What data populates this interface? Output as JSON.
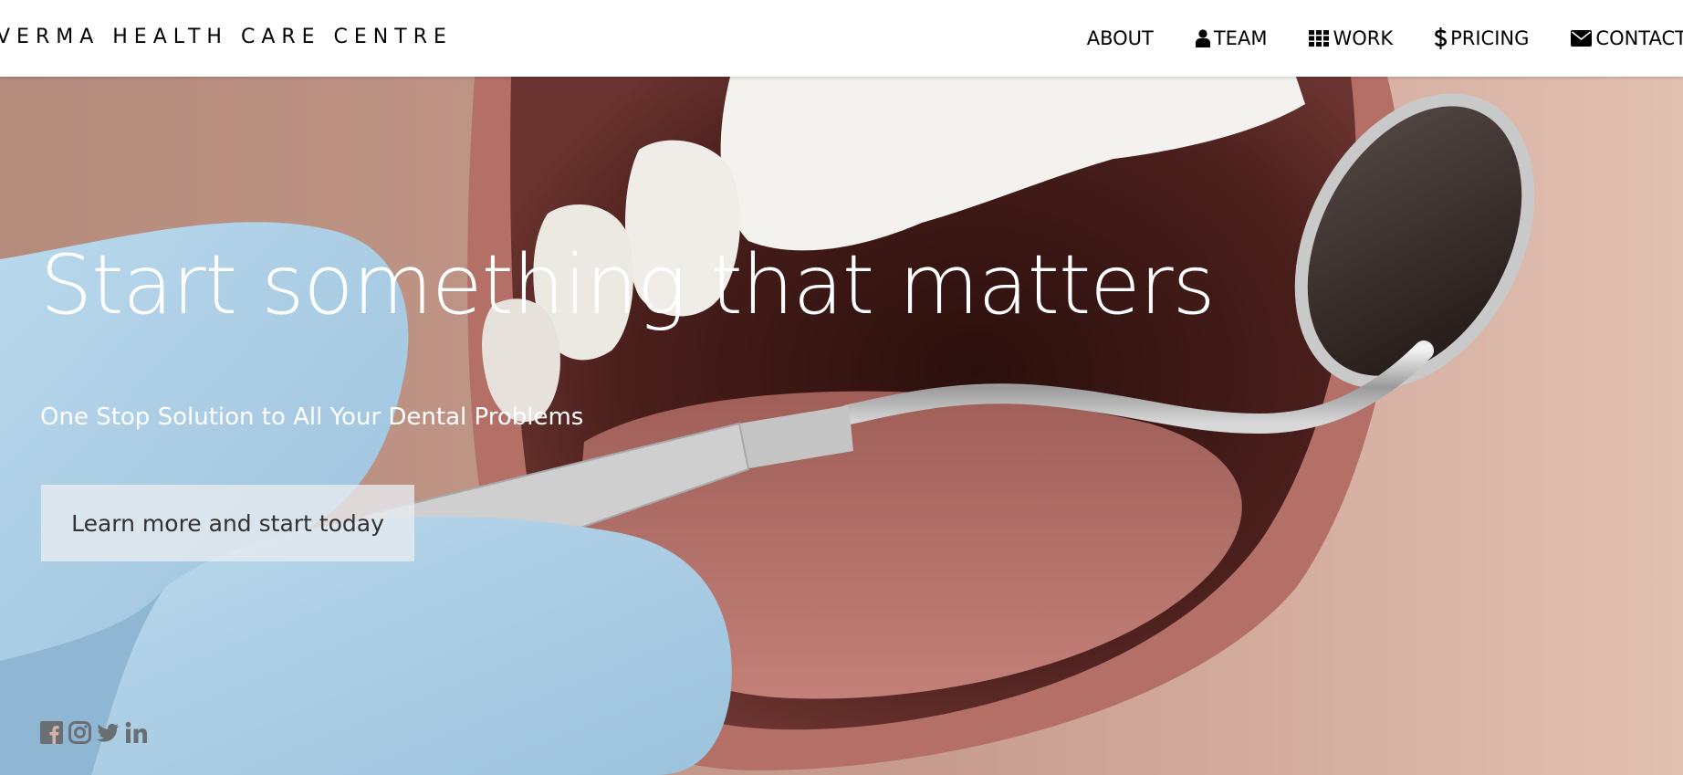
{
  "brand": {
    "name": "VERMA HEALTH CARE CENTRE"
  },
  "nav": {
    "items": [
      {
        "label": "ABOUT",
        "icon": ""
      },
      {
        "label": "TEAM",
        "icon": "user-icon"
      },
      {
        "label": "WORK",
        "icon": "grid-icon"
      },
      {
        "label": "PRICING",
        "icon": "dollar-icon"
      },
      {
        "label": "CONTACT",
        "icon": "envelope-icon"
      }
    ]
  },
  "hero": {
    "headline": "Start something that matters",
    "subheadline": "One Stop Solution to All Your Dental Problems",
    "cta_label": "Learn more and start today"
  },
  "social": {
    "items": [
      "facebook-icon",
      "instagram-icon",
      "twitter-icon",
      "linkedin-icon"
    ]
  },
  "colors": {
    "nav_bg": "#ffffff",
    "text_dark": "#000000",
    "hero_text": "#ffffff",
    "cta_bg": "#e8ecf0",
    "social_icon": "#6b6f73"
  }
}
